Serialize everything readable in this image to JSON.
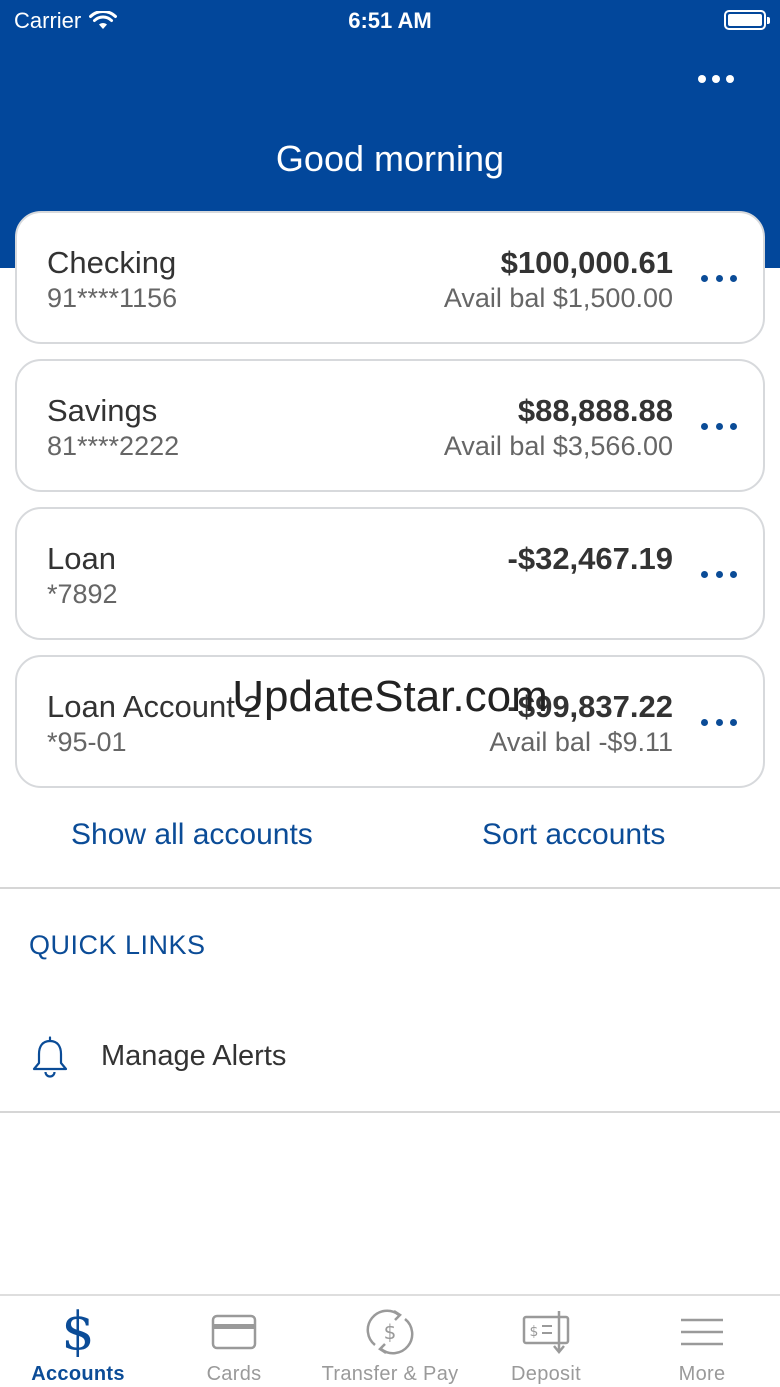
{
  "status_bar": {
    "carrier": "Carrier",
    "time": "6:51 AM"
  },
  "header": {
    "greeting": "Good morning"
  },
  "accounts": [
    {
      "name": "Checking",
      "number": "91****1156",
      "balance": "$100,000.61",
      "available": "Avail bal $1,500.00"
    },
    {
      "name": "Savings",
      "number": "81****2222",
      "balance": "$88,888.88",
      "available": "Avail bal $3,566.00"
    },
    {
      "name": "Loan",
      "number": "*7892",
      "balance": "-$32,467.19",
      "available": ""
    },
    {
      "name": "Loan Account 2",
      "number": "*95-01",
      "balance": "-$99,837.22",
      "available": "Avail bal -$9.11"
    }
  ],
  "actions": {
    "show_all": "Show all accounts",
    "sort": "Sort accounts"
  },
  "quick_links": {
    "title": "QUICK LINKS",
    "items": [
      {
        "label": "Manage Alerts",
        "icon": "bell-icon"
      }
    ]
  },
  "watermark": "UpdateStar.com",
  "tabs": [
    {
      "label": "Accounts",
      "icon": "dollar-icon",
      "active": true
    },
    {
      "label": "Cards",
      "icon": "card-icon",
      "active": false
    },
    {
      "label": "Transfer & Pay",
      "icon": "transfer-icon",
      "active": false
    },
    {
      "label": "Deposit",
      "icon": "check-deposit-icon",
      "active": false
    },
    {
      "label": "More",
      "icon": "menu-icon",
      "active": false
    }
  ],
  "colors": {
    "header": "#02479b",
    "accent": "#0b4c97",
    "inactive_tab": "#9a9a9a"
  }
}
